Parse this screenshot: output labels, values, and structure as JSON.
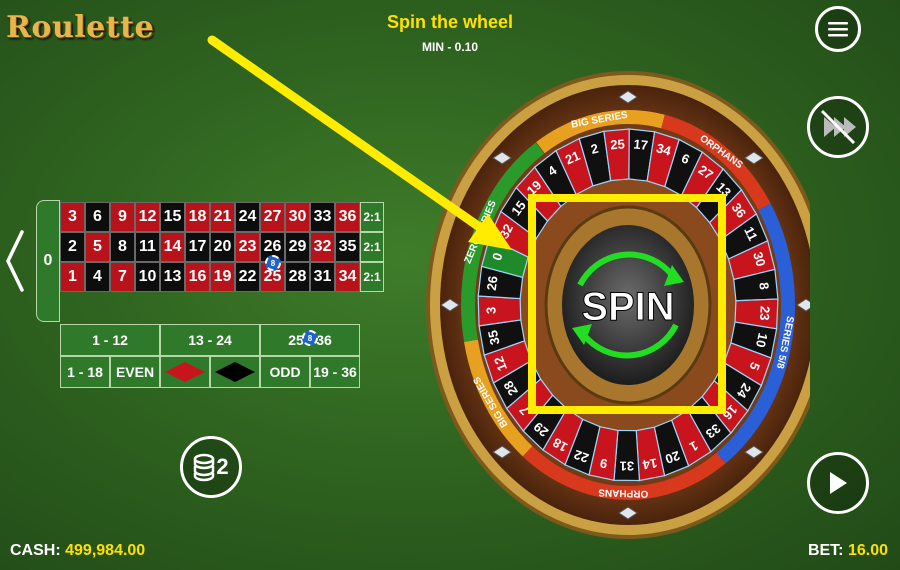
{
  "header": {
    "logo": "Roulette",
    "title": "Spin the wheel",
    "min_bet": "MIN - 0.10"
  },
  "table": {
    "zero": "0",
    "rows": [
      [
        {
          "n": "3",
          "c": "red"
        },
        {
          "n": "6",
          "c": "black"
        },
        {
          "n": "9",
          "c": "red"
        },
        {
          "n": "12",
          "c": "red"
        },
        {
          "n": "15",
          "c": "black"
        },
        {
          "n": "18",
          "c": "red"
        },
        {
          "n": "21",
          "c": "red"
        },
        {
          "n": "24",
          "c": "black"
        },
        {
          "n": "27",
          "c": "red"
        },
        {
          "n": "30",
          "c": "red"
        },
        {
          "n": "33",
          "c": "black"
        },
        {
          "n": "36",
          "c": "red"
        }
      ],
      [
        {
          "n": "2",
          "c": "black"
        },
        {
          "n": "5",
          "c": "red"
        },
        {
          "n": "8",
          "c": "black"
        },
        {
          "n": "11",
          "c": "black"
        },
        {
          "n": "14",
          "c": "red"
        },
        {
          "n": "17",
          "c": "black"
        },
        {
          "n": "20",
          "c": "black"
        },
        {
          "n": "23",
          "c": "red"
        },
        {
          "n": "26",
          "c": "black"
        },
        {
          "n": "29",
          "c": "black"
        },
        {
          "n": "32",
          "c": "red"
        },
        {
          "n": "35",
          "c": "black"
        }
      ],
      [
        {
          "n": "1",
          "c": "red"
        },
        {
          "n": "4",
          "c": "black"
        },
        {
          "n": "7",
          "c": "red"
        },
        {
          "n": "10",
          "c": "black"
        },
        {
          "n": "13",
          "c": "black"
        },
        {
          "n": "16",
          "c": "red"
        },
        {
          "n": "19",
          "c": "red"
        },
        {
          "n": "22",
          "c": "black"
        },
        {
          "n": "25",
          "c": "red"
        },
        {
          "n": "28",
          "c": "black"
        },
        {
          "n": "31",
          "c": "black"
        },
        {
          "n": "34",
          "c": "red"
        }
      ]
    ],
    "column_bets": [
      "2:1",
      "2:1",
      "2:1"
    ],
    "dozens": [
      "1 - 12",
      "13 - 24",
      "25 - 36"
    ],
    "outside": [
      "1 - 18",
      "EVEN",
      "",
      "",
      "ODD",
      "19 - 36"
    ],
    "chip_value": "8"
  },
  "wheel": {
    "spin_label": "SPIN",
    "sections": [
      "BIG SERIES",
      "ORPHANS",
      "SERIES 5/8",
      "ORPHANS",
      "BIG SERIES",
      "ZERO SERIES"
    ],
    "pockets": [
      "0",
      "32",
      "15",
      "19",
      "4",
      "21",
      "2",
      "25",
      "17",
      "34",
      "6",
      "27",
      "13",
      "36",
      "11",
      "30",
      "8",
      "23",
      "10",
      "5",
      "24",
      "16",
      "33",
      "1",
      "20",
      "14",
      "31",
      "9",
      "22",
      "18",
      "29",
      "7",
      "28",
      "12",
      "35",
      "3",
      "26"
    ],
    "colors": {
      "red": "#c8141c",
      "black": "#101010",
      "green": "#1f8a2a",
      "wood": "#6b3a1a",
      "gold": "#c79a3a",
      "highlight": "#ffec00"
    }
  },
  "buttons": {
    "chips_badge": "2"
  },
  "footer": {
    "cash_label": "CASH:",
    "cash_value": "499,984.00",
    "bet_label": "BET:",
    "bet_value": "16.00"
  }
}
